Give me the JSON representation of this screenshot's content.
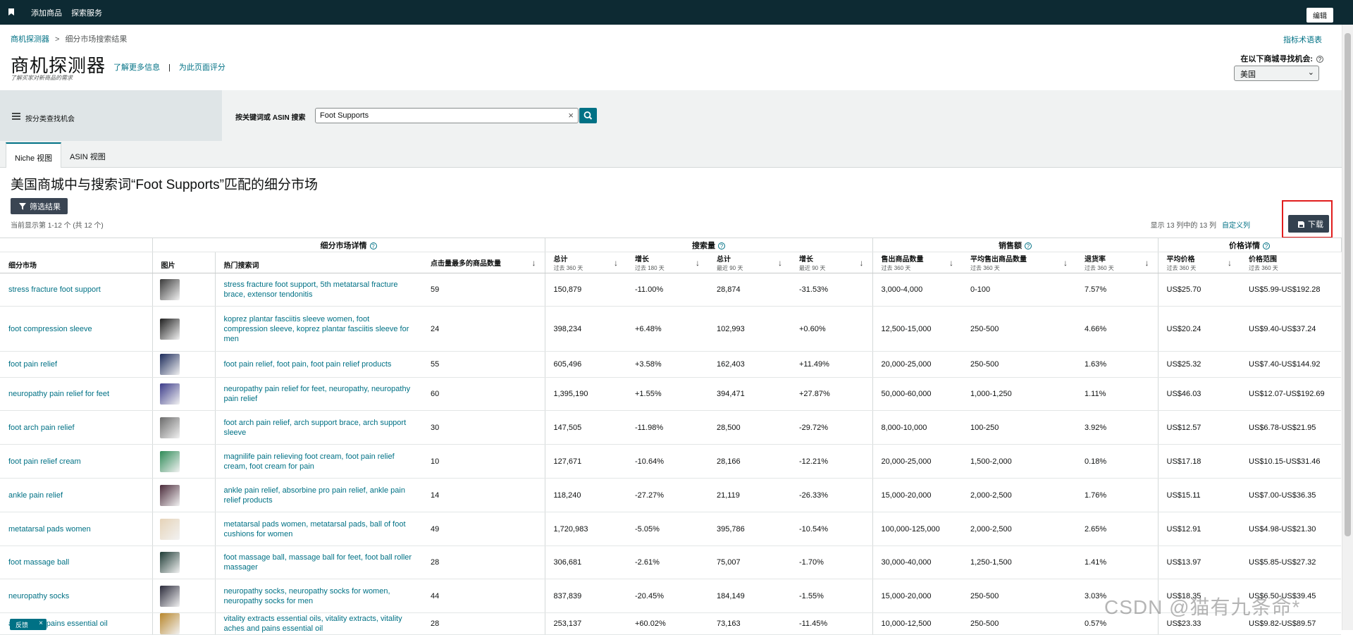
{
  "topbar": {
    "add_product": "添加商品",
    "explore_services": "探索服务",
    "edit": "编辑"
  },
  "header": {
    "breadcrumb_root": "商机探测器",
    "breadcrumb_sep": ">",
    "breadcrumb_current": "细分市场搜索结果",
    "metrics_link": "指标术语表",
    "title": "商机探测器",
    "learn_more": "了解更多信息",
    "rate_page": "为此页面评分",
    "subtitle": "了解买家对新商品的需求",
    "region_label": "在以下商城寻找机会:",
    "region_value": "美国"
  },
  "search": {
    "category_label": "按分类查找机会",
    "keyword_label": "按关键词或 ASIN 搜索",
    "query": "Foot Supports"
  },
  "tabs": {
    "niche": "Niche 视图",
    "asin": "ASIN 视图"
  },
  "results": {
    "title": "美国商城中与搜索词“Foot Supports”匹配的细分市场",
    "filter": "筛选结果",
    "showing": "当前显示第 1-12 个 (共 12 个)",
    "cols_info": "显示 13 列中的 13 列",
    "customize": "自定义列",
    "download": "下载"
  },
  "table": {
    "groups": {
      "niche_details": "细分市场详情",
      "search_volume": "搜索量",
      "sales": "销售额",
      "price_details": "价格详情"
    },
    "headers": {
      "niche": "细分市场",
      "image": "图片",
      "top_keywords": "热门搜索词",
      "top_clicked": "点击量最多的商品数量",
      "sv_total_360": "总计",
      "sv_total_360_sub": "过去 360 天",
      "sv_growth_180": "增长",
      "sv_growth_180_sub": "过去 180 天",
      "sv_total_90": "总计",
      "sv_total_90_sub": "最近 90 天",
      "sv_growth_90": "增长",
      "sv_growth_90_sub": "最近 90 天",
      "units_sold": "售出商品数量",
      "units_sold_sub": "过去 360 天",
      "avg_units": "平均售出商品数量",
      "avg_units_sub": "过去 360 天",
      "return_rate": "退货率",
      "return_rate_sub": "过去 360 天",
      "avg_price": "平均价格",
      "avg_price_sub": "过去 360 天",
      "price_range": "价格范围",
      "price_range_sub": "过去 360 天"
    },
    "rows": [
      {
        "niche": "stress fracture foot support",
        "kw": "stress fracture foot support, 5th metatarsal fracture brace, extensor tendonitis",
        "clicked": "59",
        "sv360": "150,879",
        "g180": "-11.00%",
        "sv90": "28,874",
        "g90": "-31.53%",
        "units": "3,000-4,000",
        "avg": "0-100",
        "ret": "7.57%",
        "price": "US$25.70",
        "range": "US$5.99-US$192.28"
      },
      {
        "niche": "foot compression sleeve",
        "kw": "koprez plantar fasciitis sleeve women, foot compression sleeve, koprez plantar fasciitis sleeve for men",
        "clicked": "24",
        "sv360": "398,234",
        "g180": "+6.48%",
        "sv90": "102,993",
        "g90": "+0.60%",
        "units": "12,500-15,000",
        "avg": "250-500",
        "ret": "4.66%",
        "price": "US$20.24",
        "range": "US$9.40-US$37.24"
      },
      {
        "niche": "foot pain relief",
        "kw": "foot pain relief, foot pain, foot pain relief products",
        "clicked": "55",
        "sv360": "605,496",
        "g180": "+3.58%",
        "sv90": "162,403",
        "g90": "+11.49%",
        "units": "20,000-25,000",
        "avg": "250-500",
        "ret": "1.63%",
        "price": "US$25.32",
        "range": "US$7.40-US$144.92"
      },
      {
        "niche": "neuropathy pain relief for feet",
        "kw": "neuropathy pain relief for feet, neuropathy, neuropathy pain relief",
        "clicked": "60",
        "sv360": "1,395,190",
        "g180": "+1.55%",
        "sv90": "394,471",
        "g90": "+27.87%",
        "units": "50,000-60,000",
        "avg": "1,000-1,250",
        "ret": "1.11%",
        "price": "US$46.03",
        "range": "US$12.07-US$192.69"
      },
      {
        "niche": "foot arch pain relief",
        "kw": "foot arch pain relief, arch support brace, arch support sleeve",
        "clicked": "30",
        "sv360": "147,505",
        "g180": "-11.98%",
        "sv90": "28,500",
        "g90": "-29.72%",
        "units": "8,000-10,000",
        "avg": "100-250",
        "ret": "3.92%",
        "price": "US$12.57",
        "range": "US$6.78-US$21.95"
      },
      {
        "niche": "foot pain relief cream",
        "kw": "magnilife pain relieving foot cream, foot pain relief cream, foot cream for pain",
        "clicked": "10",
        "sv360": "127,671",
        "g180": "-10.64%",
        "sv90": "28,166",
        "g90": "-12.21%",
        "units": "20,000-25,000",
        "avg": "1,500-2,000",
        "ret": "0.18%",
        "price": "US$17.18",
        "range": "US$10.15-US$31.46"
      },
      {
        "niche": "ankle pain relief",
        "kw": "ankle pain relief, absorbine pro pain relief, ankle pain relief products",
        "clicked": "14",
        "sv360": "118,240",
        "g180": "-27.27%",
        "sv90": "21,119",
        "g90": "-26.33%",
        "units": "15,000-20,000",
        "avg": "2,000-2,500",
        "ret": "1.76%",
        "price": "US$15.11",
        "range": "US$7.00-US$36.35"
      },
      {
        "niche": "metatarsal pads women",
        "kw": "metatarsal pads women, metatarsal pads, ball of foot cushions for women",
        "clicked": "49",
        "sv360": "1,720,983",
        "g180": "-5.05%",
        "sv90": "395,786",
        "g90": "-10.54%",
        "units": "100,000-125,000",
        "avg": "2,000-2,500",
        "ret": "2.65%",
        "price": "US$12.91",
        "range": "US$4.98-US$21.30"
      },
      {
        "niche": "foot massage ball",
        "kw": "foot massage ball, massage ball for feet, foot ball roller massager",
        "clicked": "28",
        "sv360": "306,681",
        "g180": "-2.61%",
        "sv90": "75,007",
        "g90": "-1.70%",
        "units": "30,000-40,000",
        "avg": "1,250-1,500",
        "ret": "1.41%",
        "price": "US$13.97",
        "range": "US$5.85-US$27.32"
      },
      {
        "niche": "neuropathy socks",
        "kw": "neuropathy socks, neuropathy socks for women, neuropathy socks for men",
        "clicked": "44",
        "sv360": "837,839",
        "g180": "-20.45%",
        "sv90": "184,149",
        "g90": "-1.55%",
        "units": "15,000-20,000",
        "avg": "250-500",
        "ret": "3.03%",
        "price": "US$18.35",
        "range": "US$6.50-US$39.45"
      },
      {
        "niche": "aches and pains essential oil",
        "kw": "vitality extracts essential oils, vitality extracts, vitality aches and pains essential oil",
        "clicked": "28",
        "sv360": "253,137",
        "g180": "+60.02%",
        "sv90": "73,163",
        "g90": "-11.45%",
        "units": "10,000-12,500",
        "avg": "250-500",
        "ret": "0.57%",
        "price": "US$23.33",
        "range": "US$9.82-US$89.57"
      }
    ]
  },
  "feedback": {
    "label": "反馈",
    "close": "×"
  },
  "watermark": "CSDN @猫有九条命*",
  "colors": {
    "topbar": "#0d2a33",
    "link": "#007185",
    "download_btn": "#33414f",
    "highlight": "#e11d1d"
  }
}
